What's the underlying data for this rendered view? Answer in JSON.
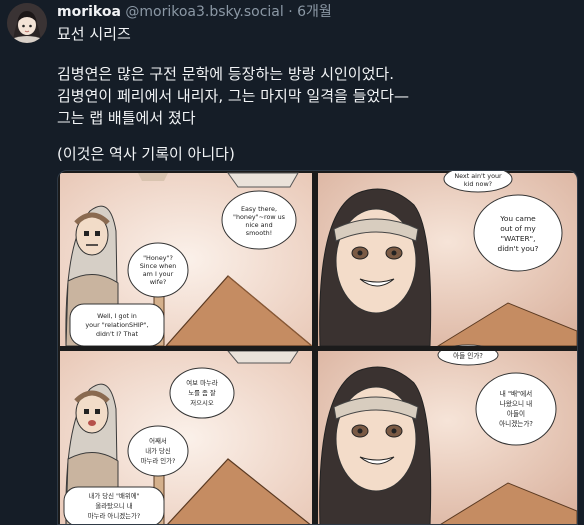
{
  "post": {
    "display_name": "morikoa",
    "handle": "@morikoa3.bsky.social",
    "separator": "·",
    "time": "6개월",
    "lines": [
      "묘선 시리즈",
      "김병연은 많은 구전 문학에 등장하는 방랑 시인이었다.",
      "김병연이 페리에서 내리자, 그는 마지막 일격을 들었다—",
      "그는 랩 배틀에서 졌다",
      "(이것은 역사 기록이 아니다)"
    ]
  },
  "comic": {
    "panel1": {
      "bubble_a": [
        "Easy there,",
        "\"honey\"~row us",
        "nice and",
        "smooth!"
      ],
      "bubble_b": [
        "\"Honey\"?",
        "Since when",
        "am I your",
        "wife?"
      ],
      "bubble_c": [
        "Well, I got in",
        "your \"relationSHIP\",",
        "didn't I? That"
      ]
    },
    "panel2": {
      "bubble_top": [
        "Next ain't your",
        "kid now?"
      ],
      "bubble_a": [
        "You came",
        "out of my",
        "\"WATER\",",
        "didn't you?"
      ]
    },
    "panel3": {
      "bubble_a": [
        "여보 마누라",
        "노를 좀 잘",
        "저으시오"
      ],
      "bubble_b": [
        "어째서",
        "내가 당신",
        "마누라 인가?"
      ],
      "bubble_c": [
        "내가 당신 \"배위에\"",
        "올라탔으니 내",
        "마누라 아니겠는가?"
      ]
    },
    "panel4": {
      "bubble_top": [
        "아들 인가?"
      ],
      "bubble_a": [
        "내 \"배\"에서",
        "나왔으니 내",
        "아들이",
        "아니겠는가?"
      ]
    }
  }
}
